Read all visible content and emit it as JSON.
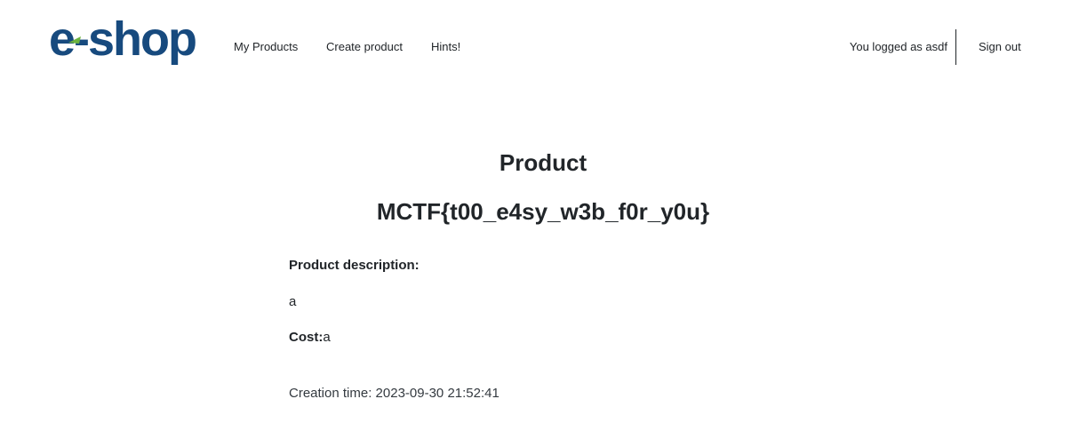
{
  "header": {
    "logo_text": "e-shop",
    "nav": [
      {
        "label": "My Products"
      },
      {
        "label": "Create product"
      },
      {
        "label": "Hints!"
      }
    ],
    "user_status": "You logged as asdf",
    "signout_label": "Sign out"
  },
  "colors": {
    "logo_blue": "#174a7e",
    "logo_green": "#6cb33f",
    "text": "#212529"
  },
  "product": {
    "heading": "Product",
    "name": "MCTF{t00_e4sy_w3b_f0r_y0u}",
    "description_label": "Product description:",
    "description_value": "a",
    "cost_label": "Cost:",
    "cost_value": "a",
    "creation_label": "Creation time:",
    "creation_value": "2023-09-30 21:52:41"
  }
}
